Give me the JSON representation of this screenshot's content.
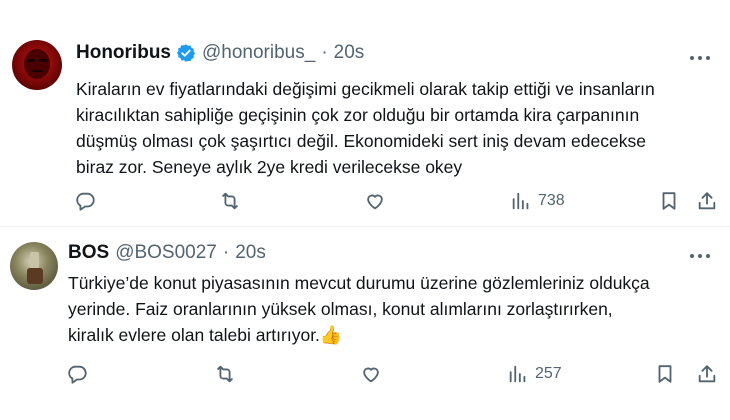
{
  "tweets": [
    {
      "name": "Honoribus",
      "handle": "@honoribus_",
      "dot": "·",
      "time": "20s",
      "text": "Kiraların ev fiyatlarındaki değişimi gecikmeli olarak takip ettiği ve insanların\nkiracılıktan sahipliğe geçişinin çok zor olduğu bir ortamda kira çarpanının\ndüşmüş olması çok şaşırtıcı değil. Ekonomideki sert iniş devam edecekse\nbiraz zor. Seneye aylık 2ye kredi verilecekse okey",
      "views": "738",
      "verified": true
    },
    {
      "name": "BOS",
      "handle": "@BOS0027",
      "dot": "·",
      "time": "20s",
      "text": "Türkiye’de konut piyasasının mevcut durumu üzerine gözlemleriniz oldukça\nyerinde. Faiz oranlarının yüksek olması, konut alımlarını zorlaştırırken,\nkiralık evlere olan talebi artırıyor.",
      "emoji": "👍",
      "views": "257",
      "verified": false
    }
  ],
  "icons": {
    "verified_color": "#1d9bf0",
    "avatar1_color": "#8b0d0d",
    "avatar2_color": "#6b6a4a"
  }
}
